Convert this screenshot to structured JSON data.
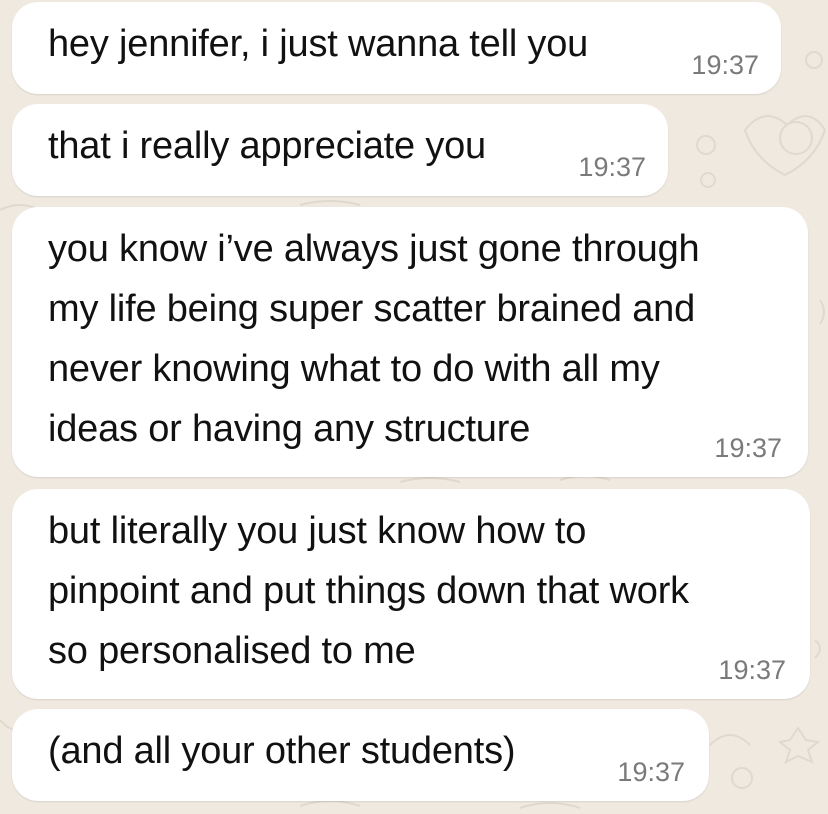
{
  "conversation": {
    "messages": [
      {
        "text": "hey jennifer, i just wanna tell you",
        "time": "19:37"
      },
      {
        "text": "that i really appreciate you",
        "time": "19:37"
      },
      {
        "text": "you know i’ve always just gone through\nmy life being super scatter brained and\nnever knowing what to do with all my\nideas or having any structure",
        "time": "19:37"
      },
      {
        "text": "but literally you just know how to\npinpoint and put things down that work\nso personalised to me",
        "time": "19:37"
      },
      {
        "text": "(and all your other students)",
        "time": "19:37"
      }
    ]
  },
  "theme": {
    "wallpaper": "#efe9e0",
    "bubble": "#ffffff",
    "text": "#111111",
    "timestamp": "#7a7a7a"
  }
}
